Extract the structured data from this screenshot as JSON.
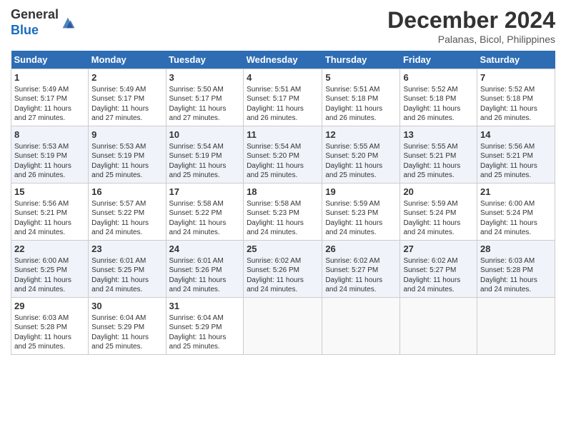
{
  "header": {
    "logo_line1": "General",
    "logo_line2": "Blue",
    "month_year": "December 2024",
    "location": "Palanas, Bicol, Philippines"
  },
  "days_of_week": [
    "Sunday",
    "Monday",
    "Tuesday",
    "Wednesday",
    "Thursday",
    "Friday",
    "Saturday"
  ],
  "weeks": [
    [
      {
        "day": "1",
        "info": "Sunrise: 5:49 AM\nSunset: 5:17 PM\nDaylight: 11 hours\nand 27 minutes."
      },
      {
        "day": "2",
        "info": "Sunrise: 5:49 AM\nSunset: 5:17 PM\nDaylight: 11 hours\nand 27 minutes."
      },
      {
        "day": "3",
        "info": "Sunrise: 5:50 AM\nSunset: 5:17 PM\nDaylight: 11 hours\nand 27 minutes."
      },
      {
        "day": "4",
        "info": "Sunrise: 5:51 AM\nSunset: 5:17 PM\nDaylight: 11 hours\nand 26 minutes."
      },
      {
        "day": "5",
        "info": "Sunrise: 5:51 AM\nSunset: 5:18 PM\nDaylight: 11 hours\nand 26 minutes."
      },
      {
        "day": "6",
        "info": "Sunrise: 5:52 AM\nSunset: 5:18 PM\nDaylight: 11 hours\nand 26 minutes."
      },
      {
        "day": "7",
        "info": "Sunrise: 5:52 AM\nSunset: 5:18 PM\nDaylight: 11 hours\nand 26 minutes."
      }
    ],
    [
      {
        "day": "8",
        "info": "Sunrise: 5:53 AM\nSunset: 5:19 PM\nDaylight: 11 hours\nand 26 minutes."
      },
      {
        "day": "9",
        "info": "Sunrise: 5:53 AM\nSunset: 5:19 PM\nDaylight: 11 hours\nand 25 minutes."
      },
      {
        "day": "10",
        "info": "Sunrise: 5:54 AM\nSunset: 5:19 PM\nDaylight: 11 hours\nand 25 minutes."
      },
      {
        "day": "11",
        "info": "Sunrise: 5:54 AM\nSunset: 5:20 PM\nDaylight: 11 hours\nand 25 minutes."
      },
      {
        "day": "12",
        "info": "Sunrise: 5:55 AM\nSunset: 5:20 PM\nDaylight: 11 hours\nand 25 minutes."
      },
      {
        "day": "13",
        "info": "Sunrise: 5:55 AM\nSunset: 5:21 PM\nDaylight: 11 hours\nand 25 minutes."
      },
      {
        "day": "14",
        "info": "Sunrise: 5:56 AM\nSunset: 5:21 PM\nDaylight: 11 hours\nand 25 minutes."
      }
    ],
    [
      {
        "day": "15",
        "info": "Sunrise: 5:56 AM\nSunset: 5:21 PM\nDaylight: 11 hours\nand 24 minutes."
      },
      {
        "day": "16",
        "info": "Sunrise: 5:57 AM\nSunset: 5:22 PM\nDaylight: 11 hours\nand 24 minutes."
      },
      {
        "day": "17",
        "info": "Sunrise: 5:58 AM\nSunset: 5:22 PM\nDaylight: 11 hours\nand 24 minutes."
      },
      {
        "day": "18",
        "info": "Sunrise: 5:58 AM\nSunset: 5:23 PM\nDaylight: 11 hours\nand 24 minutes."
      },
      {
        "day": "19",
        "info": "Sunrise: 5:59 AM\nSunset: 5:23 PM\nDaylight: 11 hours\nand 24 minutes."
      },
      {
        "day": "20",
        "info": "Sunrise: 5:59 AM\nSunset: 5:24 PM\nDaylight: 11 hours\nand 24 minutes."
      },
      {
        "day": "21",
        "info": "Sunrise: 6:00 AM\nSunset: 5:24 PM\nDaylight: 11 hours\nand 24 minutes."
      }
    ],
    [
      {
        "day": "22",
        "info": "Sunrise: 6:00 AM\nSunset: 5:25 PM\nDaylight: 11 hours\nand 24 minutes."
      },
      {
        "day": "23",
        "info": "Sunrise: 6:01 AM\nSunset: 5:25 PM\nDaylight: 11 hours\nand 24 minutes."
      },
      {
        "day": "24",
        "info": "Sunrise: 6:01 AM\nSunset: 5:26 PM\nDaylight: 11 hours\nand 24 minutes."
      },
      {
        "day": "25",
        "info": "Sunrise: 6:02 AM\nSunset: 5:26 PM\nDaylight: 11 hours\nand 24 minutes."
      },
      {
        "day": "26",
        "info": "Sunrise: 6:02 AM\nSunset: 5:27 PM\nDaylight: 11 hours\nand 24 minutes."
      },
      {
        "day": "27",
        "info": "Sunrise: 6:02 AM\nSunset: 5:27 PM\nDaylight: 11 hours\nand 24 minutes."
      },
      {
        "day": "28",
        "info": "Sunrise: 6:03 AM\nSunset: 5:28 PM\nDaylight: 11 hours\nand 24 minutes."
      }
    ],
    [
      {
        "day": "29",
        "info": "Sunrise: 6:03 AM\nSunset: 5:28 PM\nDaylight: 11 hours\nand 25 minutes."
      },
      {
        "day": "30",
        "info": "Sunrise: 6:04 AM\nSunset: 5:29 PM\nDaylight: 11 hours\nand 25 minutes."
      },
      {
        "day": "31",
        "info": "Sunrise: 6:04 AM\nSunset: 5:29 PM\nDaylight: 11 hours\nand 25 minutes."
      },
      {
        "day": "",
        "info": ""
      },
      {
        "day": "",
        "info": ""
      },
      {
        "day": "",
        "info": ""
      },
      {
        "day": "",
        "info": ""
      }
    ]
  ]
}
